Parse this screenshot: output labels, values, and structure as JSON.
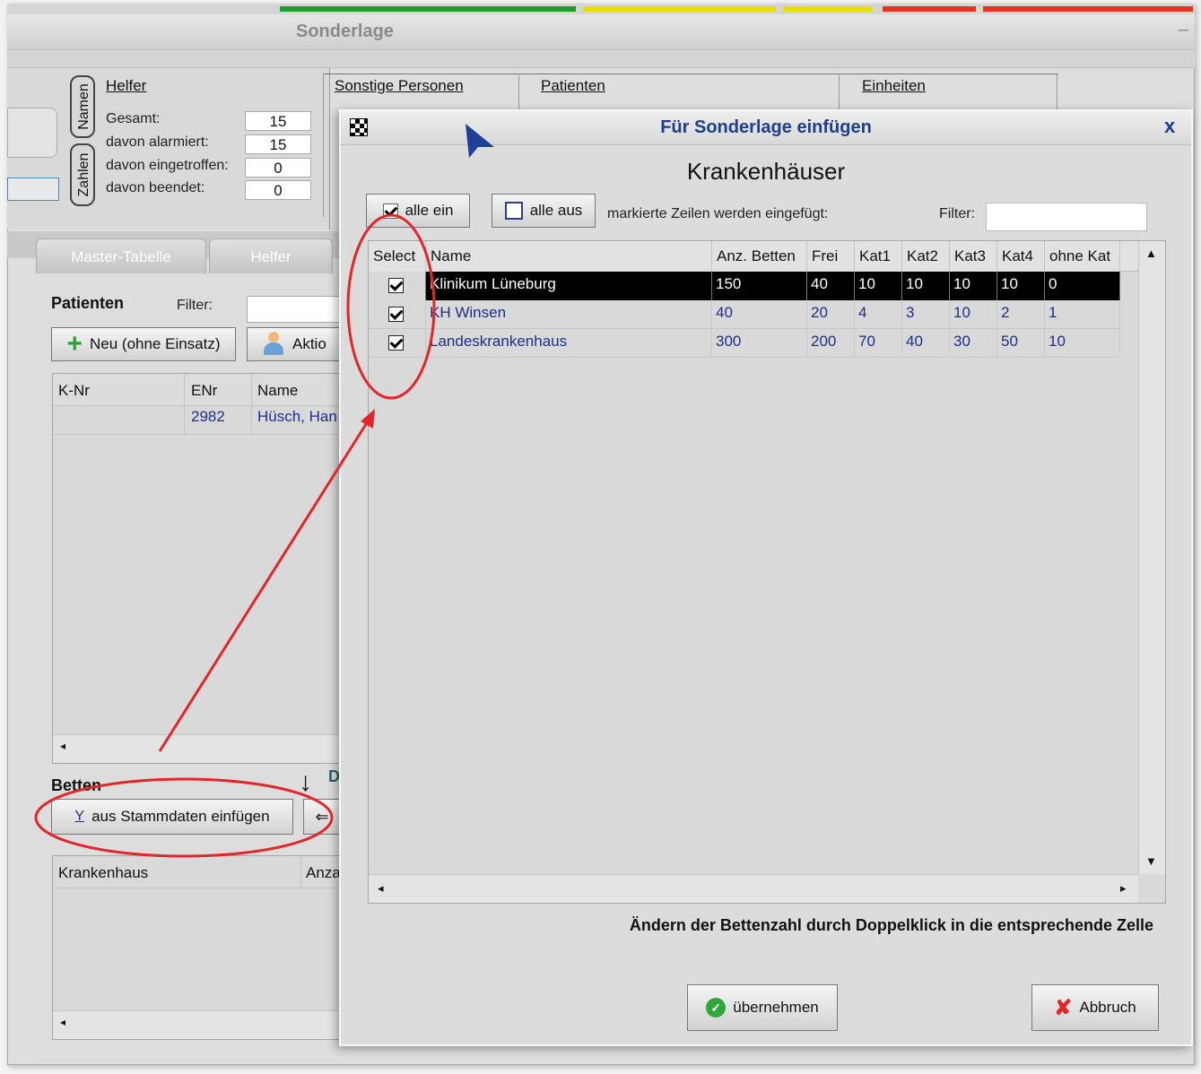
{
  "app": {
    "title": "Sonderlage",
    "minimize_glyph": "–"
  },
  "colors": {
    "status_green": "#1f9d2a",
    "status_yellow": "#e5e000",
    "status_red": "#e8321e",
    "link_blue": "#1d2f8a",
    "dialog_title": "#1d3e8c",
    "annotation_red": "#e2262a"
  },
  "vertical_tabs": {
    "namen": "Namen",
    "zahlen": "Zahlen"
  },
  "helfer": {
    "header": "Helfer",
    "rows": [
      {
        "label": "Gesamt:",
        "value": "15"
      },
      {
        "label": "davon alarmiert:",
        "value": "15"
      },
      {
        "label": "davon eingetroffen:",
        "value": "0"
      },
      {
        "label": "davon beendet:",
        "value": "0"
      }
    ]
  },
  "sections": {
    "sonstige": "Sonstige Personen",
    "patienten": "Patienten",
    "einheiten": "Einheiten"
  },
  "tabs": {
    "master": "Master-Tabelle",
    "helfer": "Helfer"
  },
  "patienten_panel": {
    "title": "Patienten",
    "filter_label": "Filter:",
    "new_button": "Neu (ohne Einsatz)",
    "action_button": "Aktio",
    "columns": [
      "K-Nr",
      "ENr",
      "Name"
    ],
    "rows": [
      {
        "knr": "",
        "enr": "2982",
        "name": "Hüsch, Han"
      }
    ]
  },
  "betten_panel": {
    "title": "Betten",
    "extra_label": "D",
    "insert_button": "aus Stammdaten einfügen",
    "columns": [
      "Krankenhaus",
      "Anza"
    ]
  },
  "dialog": {
    "title": "Für Sonderlage einfügen",
    "close": "x",
    "heading": "Krankenhäuser",
    "all_on": "alle ein",
    "all_off": "alle aus",
    "hint": "markierte Zeilen werden eingefügt:",
    "filter_label": "Filter:",
    "columns": [
      "Select",
      "Name",
      "Anz. Betten",
      "Frei",
      "Kat1",
      "Kat2",
      "Kat3",
      "Kat4",
      "ohne Kat"
    ],
    "rows": [
      {
        "name": "Klinikum Lüneburg",
        "betten": "150",
        "frei": "40",
        "kat1": "10",
        "kat2": "10",
        "kat3": "10",
        "kat4": "10",
        "ohne": "0",
        "selected": true
      },
      {
        "name": "KH Winsen",
        "betten": "40",
        "frei": "20",
        "kat1": "4",
        "kat2": "3",
        "kat3": "10",
        "kat4": "2",
        "ohne": "1",
        "selected": true
      },
      {
        "name": "Landeskrankenhaus",
        "betten": "300",
        "frei": "200",
        "kat1": "70",
        "kat2": "40",
        "kat3": "30",
        "kat4": "50",
        "ohne": "10",
        "selected": true
      }
    ],
    "footer_note": "Ändern der Bettenzahl durch Doppelklick in die entsprechende Zelle",
    "ok_button": "übernehmen",
    "cancel_button": "Abbruch"
  }
}
